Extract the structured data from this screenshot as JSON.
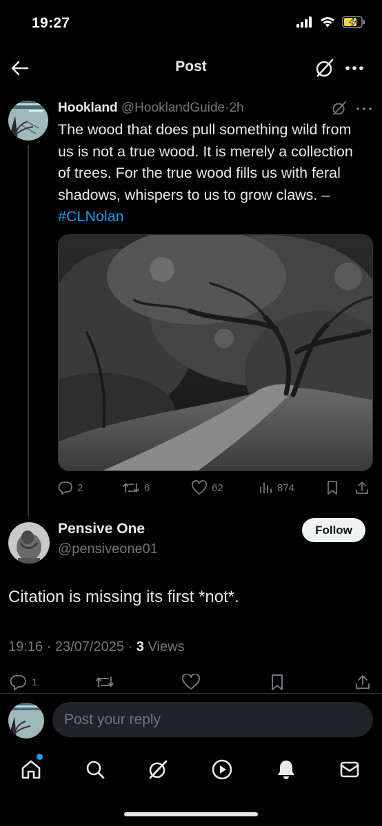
{
  "status_bar": {
    "time": "19:27"
  },
  "header": {
    "title": "Post"
  },
  "parent_post": {
    "author_name": "Hookland",
    "handle": "@HooklandGuide",
    "separator": "·",
    "time": "2h",
    "text": "The wood that does pull something wild from us is not a true wood. It is merely a collection of trees. For the true wood fills us with feral shadows, whispers to us to grow claws. – ",
    "hashtag": "#CLNolan",
    "stats": {
      "replies": "2",
      "reposts": "6",
      "likes": "62",
      "views": "874"
    }
  },
  "reply_post": {
    "author_name": "Pensive One",
    "handle": "@pensiveone01",
    "follow_label": "Follow",
    "text": "Citation is missing its first *not*.",
    "time": "19:16",
    "date": "23/07/2025",
    "separator": "·",
    "views_count": "3",
    "views_label": "Views",
    "stats": {
      "replies": "1"
    }
  },
  "composer": {
    "placeholder": "Post your reply"
  },
  "colors": {
    "accent": "#1d9bf0",
    "background": "#000000",
    "muted": "#71767b",
    "text": "#e7e9ea"
  },
  "nav": {
    "items": [
      "home-icon",
      "search-icon",
      "grok-icon",
      "video-icon",
      "notifications-icon",
      "messages-icon"
    ]
  }
}
